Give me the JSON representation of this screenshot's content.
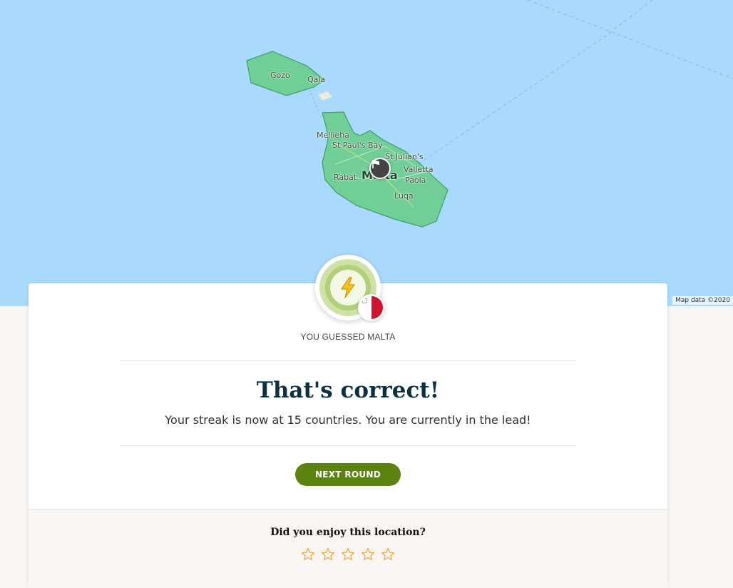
{
  "map": {
    "labels": {
      "gozo": "Gozo",
      "qala": "Qala",
      "mellieha": "Mellieha",
      "st_pauls_bay": "St Paul's Bay",
      "st_julians": "St Julian's",
      "rabat": "Rabat",
      "malta": "Malta",
      "valletta": "Valletta",
      "paola": "Paola",
      "luqa": "Luqa"
    },
    "attribution": "Map data ©2020",
    "colors": {
      "water": "#a9dafe",
      "land_fill": "#6ccc8c",
      "land_stroke": "#3d9d6a"
    },
    "marker_icon": "flag-icon"
  },
  "result": {
    "badge_icon": "lightning-icon",
    "flag_icon": "malta-flag-icon",
    "guessed_text": "YOU GUESSED MALTA",
    "title": "That's correct!",
    "subtitle": "Your streak is now at 15 countries. You are currently in the lead!",
    "next_button": "NEXT ROUND"
  },
  "rating": {
    "question": "Did you enjoy this location?",
    "max_stars": 5,
    "value": 0
  },
  "colors": {
    "accent": "#5c8210",
    "title": "#0e3142",
    "star": "#e9a640"
  }
}
